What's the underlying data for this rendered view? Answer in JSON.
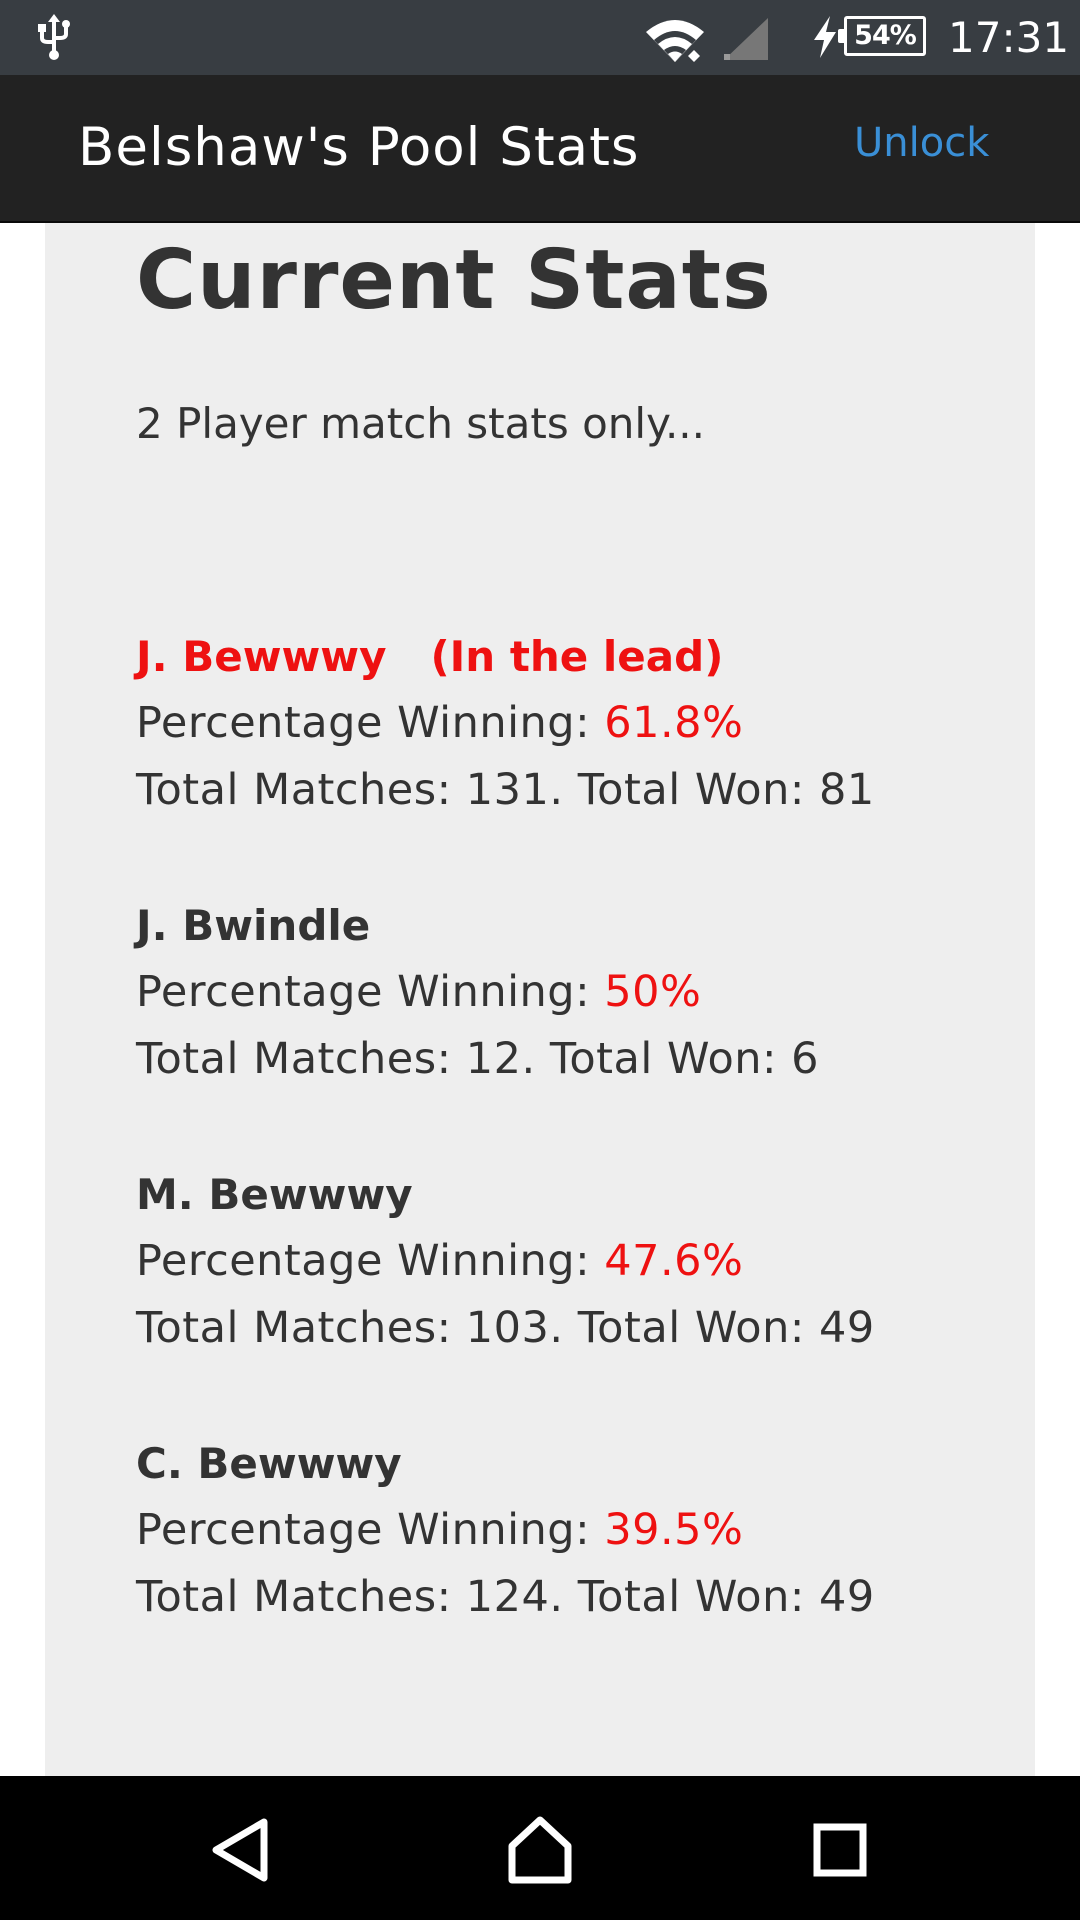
{
  "status_bar": {
    "usb_icon": "usb-icon",
    "wifi_icon": "wifi-icon",
    "signal_icon": "cell-signal-icon",
    "charging_icon": "lightning-bolt-icon",
    "battery": "54%",
    "time": "17:31"
  },
  "app_bar": {
    "title": "Belshaw's Pool Stats",
    "unlock_label": "Unlock"
  },
  "main": {
    "title": "Current Stats",
    "subtitle": "2 Player match stats only..."
  },
  "players": [
    {
      "name": "J. Bewwwy",
      "lead_tag": "(In the lead)",
      "percentage_label": "Percentage Winning: ",
      "percentage": "61.8%",
      "totals": "Total Matches: 131. Total Won: 81"
    },
    {
      "name": "J. Bwindle",
      "percentage_label": "Percentage Winning: ",
      "percentage": "50%",
      "totals": "Total Matches: 12. Total Won: 6"
    },
    {
      "name": "M. Bewwwy",
      "percentage_label": "Percentage Winning: ",
      "percentage": "47.6%",
      "totals": "Total Matches: 103. Total Won: 49"
    },
    {
      "name": "C. Bewwwy",
      "percentage_label": "Percentage Winning: ",
      "percentage": "39.5%",
      "totals": "Total Matches: 124. Total Won: 49"
    }
  ],
  "nav_bar": {
    "back_icon": "back-triangle-icon",
    "home_icon": "home-icon",
    "recent_icon": "recent-apps-icon"
  },
  "colors": {
    "status_bar": "#383d42",
    "app_bar": "#222222",
    "panel": "#eeeeee",
    "accent_link": "#3a8fd6",
    "highlight_red": "#ee1111",
    "text": "#333333"
  }
}
